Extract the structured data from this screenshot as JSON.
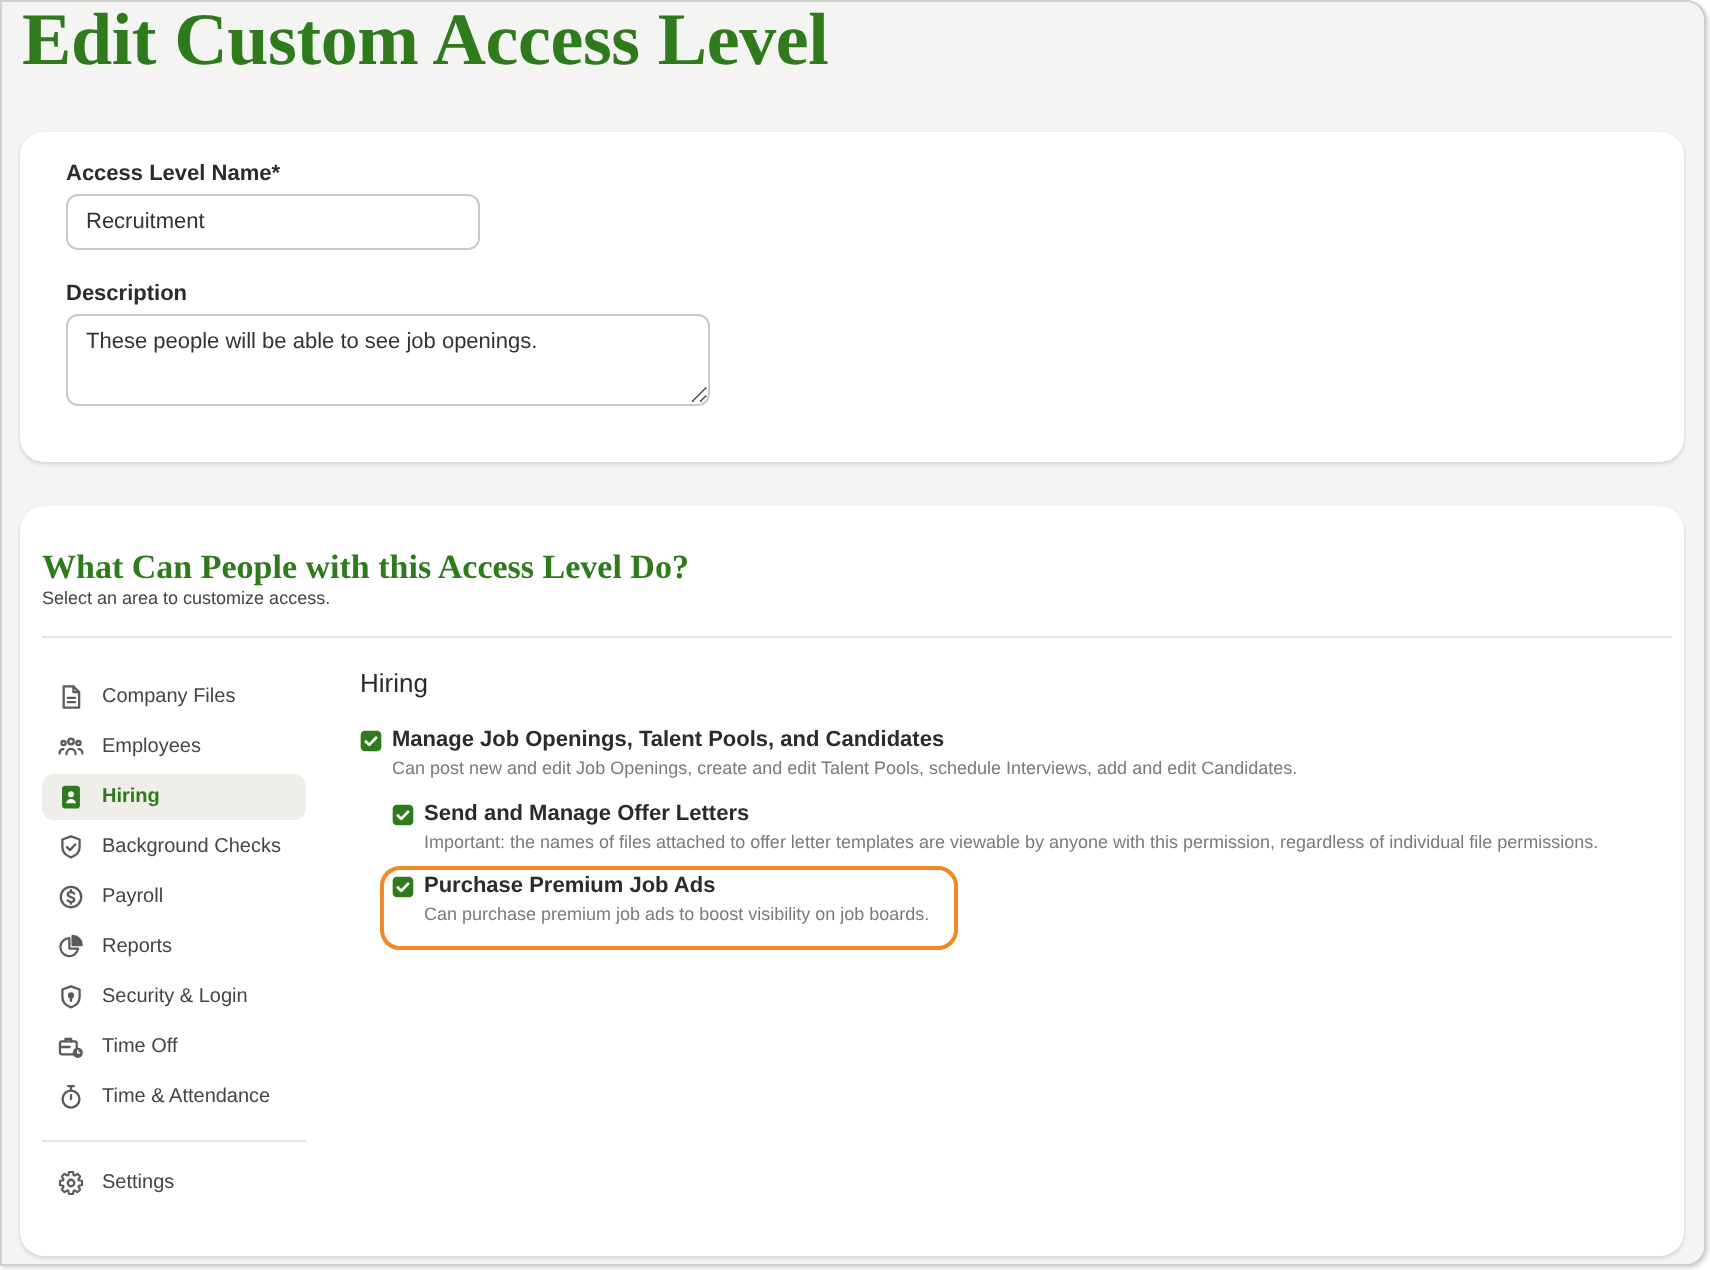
{
  "page_title": "Edit Custom Access Level",
  "details_form": {
    "fields": [
      {
        "kind": "input",
        "label": "Access Level Name*",
        "value": "Recruitment"
      },
      {
        "kind": "textarea",
        "label": "Description",
        "value": "These people will be able to see job openings."
      }
    ]
  },
  "access_section": {
    "heading": "What Can People with this Access Level Do?",
    "subtitle": "Select an area to customize access.",
    "areas": [
      {
        "label": "Company Files",
        "selected": false
      },
      {
        "label": "Employees",
        "selected": false
      },
      {
        "label": "Hiring",
        "selected": true
      },
      {
        "label": "Background Checks",
        "selected": false
      },
      {
        "label": "Payroll",
        "selected": false
      },
      {
        "label": "Reports",
        "selected": false
      },
      {
        "label": "Security & Login",
        "selected": false
      },
      {
        "label": "Time Off",
        "selected": false
      },
      {
        "label": "Time & Attendance",
        "selected": false
      }
    ],
    "footer_areas": [
      {
        "label": "Settings",
        "selected": false
      }
    ],
    "panel": {
      "title": "Hiring",
      "permissions": [
        {
          "title": "Manage Job Openings, Talent Pools, and Candidates",
          "description": "Can post new and edit Job Openings, create and edit Talent Pools, schedule Interviews, add and edit Candidates.",
          "checked": true,
          "children": [
            {
              "title": "Send and Manage Offer Letters",
              "description": "Important: the names of files attached to offer letter templates are viewable by anyone with this permission, regardless of individual file permissions.",
              "checked": true
            },
            {
              "title": "Purchase Premium Job Ads",
              "description": "Can purchase premium job ads to boost visibility on job boards.",
              "checked": true,
              "highlighted": true
            }
          ]
        }
      ]
    }
  }
}
